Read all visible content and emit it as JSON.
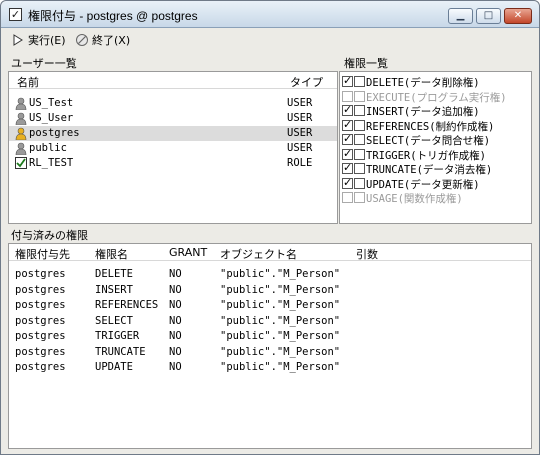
{
  "window": {
    "title": "権限付与 - postgres @ postgres",
    "minimize": "▁",
    "maximize": "□",
    "close": "✕"
  },
  "toolbar": {
    "execute_label": "実行(E)",
    "exit_label": "終了(X)"
  },
  "users_section": {
    "label": "ユーザー一覧",
    "columns": [
      "名前",
      "タイプ"
    ],
    "rows": [
      {
        "name": "US_Test",
        "type": "USER",
        "icon": "user-icon",
        "selected": false
      },
      {
        "name": "US_User",
        "type": "USER",
        "icon": "user-icon",
        "selected": false
      },
      {
        "name": "postgres",
        "type": "USER",
        "icon": "admin-user-icon",
        "selected": true
      },
      {
        "name": "public",
        "type": "USER",
        "icon": "user-icon",
        "selected": false
      },
      {
        "name": "RL_TEST",
        "type": "ROLE",
        "icon": "role-check-icon",
        "selected": false
      }
    ]
  },
  "perms_section": {
    "label": "権限一覧",
    "items": [
      {
        "label": "DELETE(データ削除権)",
        "outer": true,
        "inner": false,
        "enabled": true
      },
      {
        "label": "EXECUTE(プログラム実行権)",
        "outer": false,
        "inner": false,
        "enabled": false
      },
      {
        "label": "INSERT(データ追加権)",
        "outer": true,
        "inner": false,
        "enabled": true
      },
      {
        "label": "REFERENCES(制約作成権)",
        "outer": true,
        "inner": false,
        "enabled": true
      },
      {
        "label": "SELECT(データ問合せ権)",
        "outer": true,
        "inner": false,
        "enabled": true
      },
      {
        "label": "TRIGGER(トリガ作成権)",
        "outer": true,
        "inner": false,
        "enabled": true
      },
      {
        "label": "TRUNCATE(データ消去権)",
        "outer": true,
        "inner": false,
        "enabled": true
      },
      {
        "label": "UPDATE(データ更新権)",
        "outer": true,
        "inner": false,
        "enabled": true
      },
      {
        "label": "USAGE(関数作成権)",
        "outer": false,
        "inner": false,
        "enabled": false
      }
    ]
  },
  "granted_section": {
    "label": "付与済みの権限",
    "columns": [
      "権限付与先",
      "権限名",
      "GRANT",
      "オブジェクト名",
      "引数"
    ],
    "rows": [
      {
        "grantee": "postgres",
        "privilege": "DELETE",
        "grant": "NO",
        "object": "\"public\".\"M_Person\"",
        "args": ""
      },
      {
        "grantee": "postgres",
        "privilege": "INSERT",
        "grant": "NO",
        "object": "\"public\".\"M_Person\"",
        "args": ""
      },
      {
        "grantee": "postgres",
        "privilege": "REFERENCES",
        "grant": "NO",
        "object": "\"public\".\"M_Person\"",
        "args": ""
      },
      {
        "grantee": "postgres",
        "privilege": "SELECT",
        "grant": "NO",
        "object": "\"public\".\"M_Person\"",
        "args": ""
      },
      {
        "grantee": "postgres",
        "privilege": "TRIGGER",
        "grant": "NO",
        "object": "\"public\".\"M_Person\"",
        "args": ""
      },
      {
        "grantee": "postgres",
        "privilege": "TRUNCATE",
        "grant": "NO",
        "object": "\"public\".\"M_Person\"",
        "args": ""
      },
      {
        "grantee": "postgres",
        "privilege": "UPDATE",
        "grant": "NO",
        "object": "\"public\".\"M_Person\"",
        "args": ""
      }
    ]
  }
}
